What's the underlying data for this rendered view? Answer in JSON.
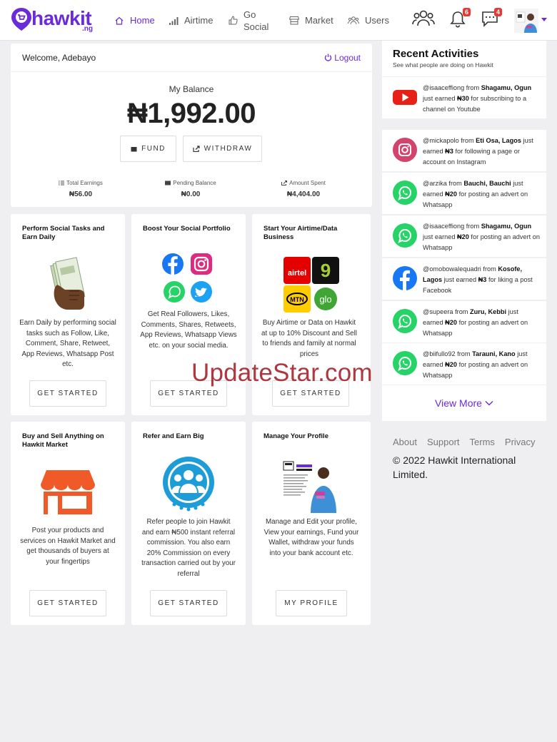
{
  "brand": {
    "name": "hawkit",
    "suffix": ".ng",
    "color": "#6a2bd8"
  },
  "nav": [
    {
      "label": "Home",
      "icon": "home-icon",
      "active": true
    },
    {
      "label": "Airtime",
      "icon": "signal-icon"
    },
    {
      "label": "Go Social",
      "icon": "thumbs-up-icon"
    },
    {
      "label": "Market",
      "icon": "store-icon"
    },
    {
      "label": "Users",
      "icon": "users-icon"
    }
  ],
  "header": {
    "notifications_count": "6",
    "messages_count": "4"
  },
  "account": {
    "welcome": "Welcome, Adebayo",
    "logout": "Logout",
    "balance_label": "My Balance",
    "balance": "₦1,992.00",
    "fund_label": "FUND",
    "withdraw_label": "WITHDRAW",
    "stats": [
      {
        "label": "Total Earnings",
        "value": "₦56.00",
        "icon": "list-icon"
      },
      {
        "label": "Pending Balance",
        "value": "₦0.00",
        "icon": "wallet-icon"
      },
      {
        "label": "Amount Spent",
        "value": "₦4,404.00",
        "icon": "share-icon"
      }
    ]
  },
  "tasks": [
    {
      "title": "Perform Social Tasks and Earn Daily",
      "desc": "Earn Daily by performing social tasks such as Follow, Like, Comment, Share, Retweet, App Reviews, Whatsapp Post etc.",
      "button": "GET STARTED",
      "icon": "money-hand-icon"
    },
    {
      "title": "Boost Your Social Portfolio",
      "desc": "Get Real Followers, Likes, Comments, Shares, Retweets, App Reviews, Whatsapp Views etc. on your social media.",
      "button": "GET STARTED",
      "icon": "social-logos-icon"
    },
    {
      "title": "Start Your Airtime/Data Business",
      "desc": "Buy Airtime or Data on Hawkit at up to 10% Discount and Sell to friends and family at normal prices",
      "button": "GET STARTED",
      "icon": "telecom-logos-icon"
    },
    {
      "title": "Buy and Sell Anything on Hawkit Market",
      "desc": "Post your products and services on Hawkit Market and get thousands of buyers at your fingertips",
      "button": "GET STARTED",
      "icon": "storefront-icon"
    },
    {
      "title": "Refer and Earn Big",
      "desc": "Refer people to join Hawkit and earn ₦500 instant referral commission. You also earn 20% Commission on every transaction carried out by your referral",
      "button": "GET STARTED",
      "icon": "referral-group-icon"
    },
    {
      "title": "Manage Your Profile",
      "desc": "Manage and Edit your profile, View your earnings, Fund your Wallet, withdraw your funds into your bank account etc.",
      "button": "MY PROFILE",
      "icon": "profile-flyer-icon"
    }
  ],
  "recent": {
    "title": "Recent Activities",
    "subtitle": "See what people are doing on Hawkit",
    "items": [
      {
        "icon": "youtube-icon",
        "user": "@isaaceffiong from ",
        "place": "Shagamu, Ogun",
        "mid": " just earned ",
        "amount": "₦30",
        "rest": " for subscribing to a channel on Youtube"
      },
      {
        "icon": "instagram-icon",
        "user": "@mickapolo from ",
        "place": "Eti Osa, Lagos",
        "mid": " just earned ",
        "amount": "₦3",
        "rest": " for following a page or account on Instagram"
      },
      {
        "icon": "whatsapp-icon",
        "user": "@arzika from ",
        "place": "Bauchi, Bauchi",
        "mid": " just earned ",
        "amount": "₦20",
        "rest": " for posting an advert on Whatsapp"
      },
      {
        "icon": "whatsapp-icon",
        "user": "@isaaceffiong from ",
        "place": "Shagamu, Ogun",
        "mid": " just earned ",
        "amount": "₦20",
        "rest": " for posting an advert on Whatsapp"
      },
      {
        "icon": "facebook-icon",
        "user": "@omobowalequadri from ",
        "place": "Kosofe, Lagos",
        "mid": " just earned ",
        "amount": "₦3",
        "rest": " for liking a post Facebook"
      },
      {
        "icon": "whatsapp-icon",
        "user": "@supeera from ",
        "place": "Zuru, Kebbi",
        "mid": " just earned ",
        "amount": "₦20",
        "rest": " for posting an advert on Whatsapp"
      },
      {
        "icon": "whatsapp-icon",
        "user": "@biifullo92 from ",
        "place": "Tarauni, Kano",
        "mid": " just earned ",
        "amount": "₦20",
        "rest": " for posting an advert on Whatsapp"
      }
    ],
    "view_more": "View More"
  },
  "footer": {
    "links": [
      "About",
      "Support",
      "Terms",
      "Privacy"
    ],
    "copyright": "© 2022 Hawkit International Limited."
  },
  "watermark": "UpdateStar.com"
}
